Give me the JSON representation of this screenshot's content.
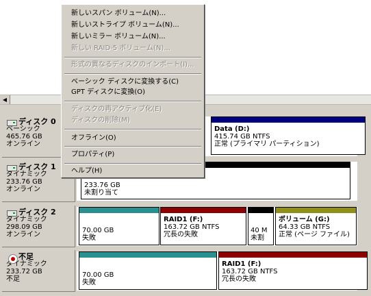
{
  "context_menu": {
    "items": [
      {
        "label": "新しいスパン ボリューム(N)...",
        "disabled": false
      },
      {
        "label": "新しいストライプ ボリューム(N)...",
        "disabled": false
      },
      {
        "label": "新しいミラー ボリューム(N)...",
        "disabled": false
      },
      {
        "label": "新しい RAID-5 ボリューム(N)...",
        "disabled": true
      },
      {
        "label": "形式の異なるディスクのインポート(I)...",
        "disabled": true
      },
      {
        "label": "ベーシック ディスクに変換する(C)",
        "disabled": false
      },
      {
        "label": "GPT ディスクに変換(O)",
        "disabled": false
      },
      {
        "label": "ディスクの再アクティブ化(E)",
        "disabled": true
      },
      {
        "label": "ディスクの削除(M)",
        "disabled": true
      },
      {
        "label": "オフライン(O)",
        "disabled": false
      },
      {
        "label": "プロパティ(P)",
        "disabled": false
      },
      {
        "label": "ヘルプ(H)",
        "disabled": false
      }
    ]
  },
  "disks": [
    {
      "name": "ディスク 0",
      "type": "ベーシック",
      "size": "465.76 GB",
      "status": "オンライン",
      "volumes": [
        {
          "name": "Data (D:)",
          "size": "415.74 GB NTFS",
          "status": "正常 (プライマリ パーティション)",
          "color": "#000080"
        }
      ]
    },
    {
      "name": "ディスク 1",
      "type": "ダイナミック",
      "size": "233.76 GB",
      "status": "オンライン",
      "volumes": [
        {
          "name": "",
          "size": "233.76 GB",
          "status": "未割り当て",
          "color": "#000000"
        }
      ]
    },
    {
      "name": "ディスク 2",
      "type": "ダイナミック",
      "size": "298.09 GB",
      "status": "オンライン",
      "volumes": [
        {
          "name": "",
          "size": "70.00 GB",
          "status": "失敗",
          "color": "#2a8f8f"
        },
        {
          "name": "RAID1 (F:)",
          "size": "163.72 GB NTFS",
          "status": "冗長の失敗",
          "color": "#8b0000"
        },
        {
          "name": "",
          "size": "40 M",
          "status": "未割",
          "color": "#000000"
        },
        {
          "name": "ボリューム (G:)",
          "size": "64.33 GB NTFS",
          "status": "正常 (ページ ファイル)",
          "color": "#8f8f1a"
        }
      ]
    },
    {
      "name": "不足",
      "type": "ダイナミック",
      "size": "233.72 GB",
      "status": "不足",
      "volumes": [
        {
          "name": "",
          "size": "70.00 GB",
          "status": "失敗",
          "color": "#2a8f8f"
        },
        {
          "name": "RAID1 (F:)",
          "size": "163.72 GB NTFS",
          "status": "冗長の失敗",
          "color": "#8b0000"
        }
      ]
    }
  ],
  "scroll_left_glyph": "◀"
}
